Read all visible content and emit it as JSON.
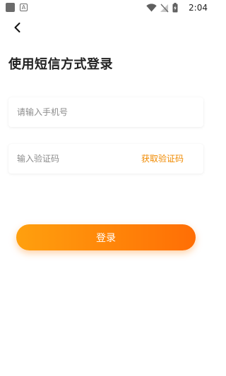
{
  "status_bar": {
    "time": "2:04",
    "a_icon_letter": "A",
    "icons": [
      "app-notification-icon",
      "a-notification-icon",
      "wifi-icon",
      "no-signal-icon",
      "battery-charging-icon"
    ]
  },
  "header": {
    "back_icon": "chevron-left-icon",
    "title": "使用短信方式登录"
  },
  "form": {
    "phone_placeholder": "请输入手机号",
    "phone_value": "",
    "code_placeholder": "输入验证码",
    "code_value": "",
    "get_code_label": "获取验证码",
    "login_label": "登录"
  },
  "colors": {
    "accent": "#f08a00",
    "button_gradient_start": "#ffa00e",
    "button_gradient_end": "#ff6e05"
  }
}
